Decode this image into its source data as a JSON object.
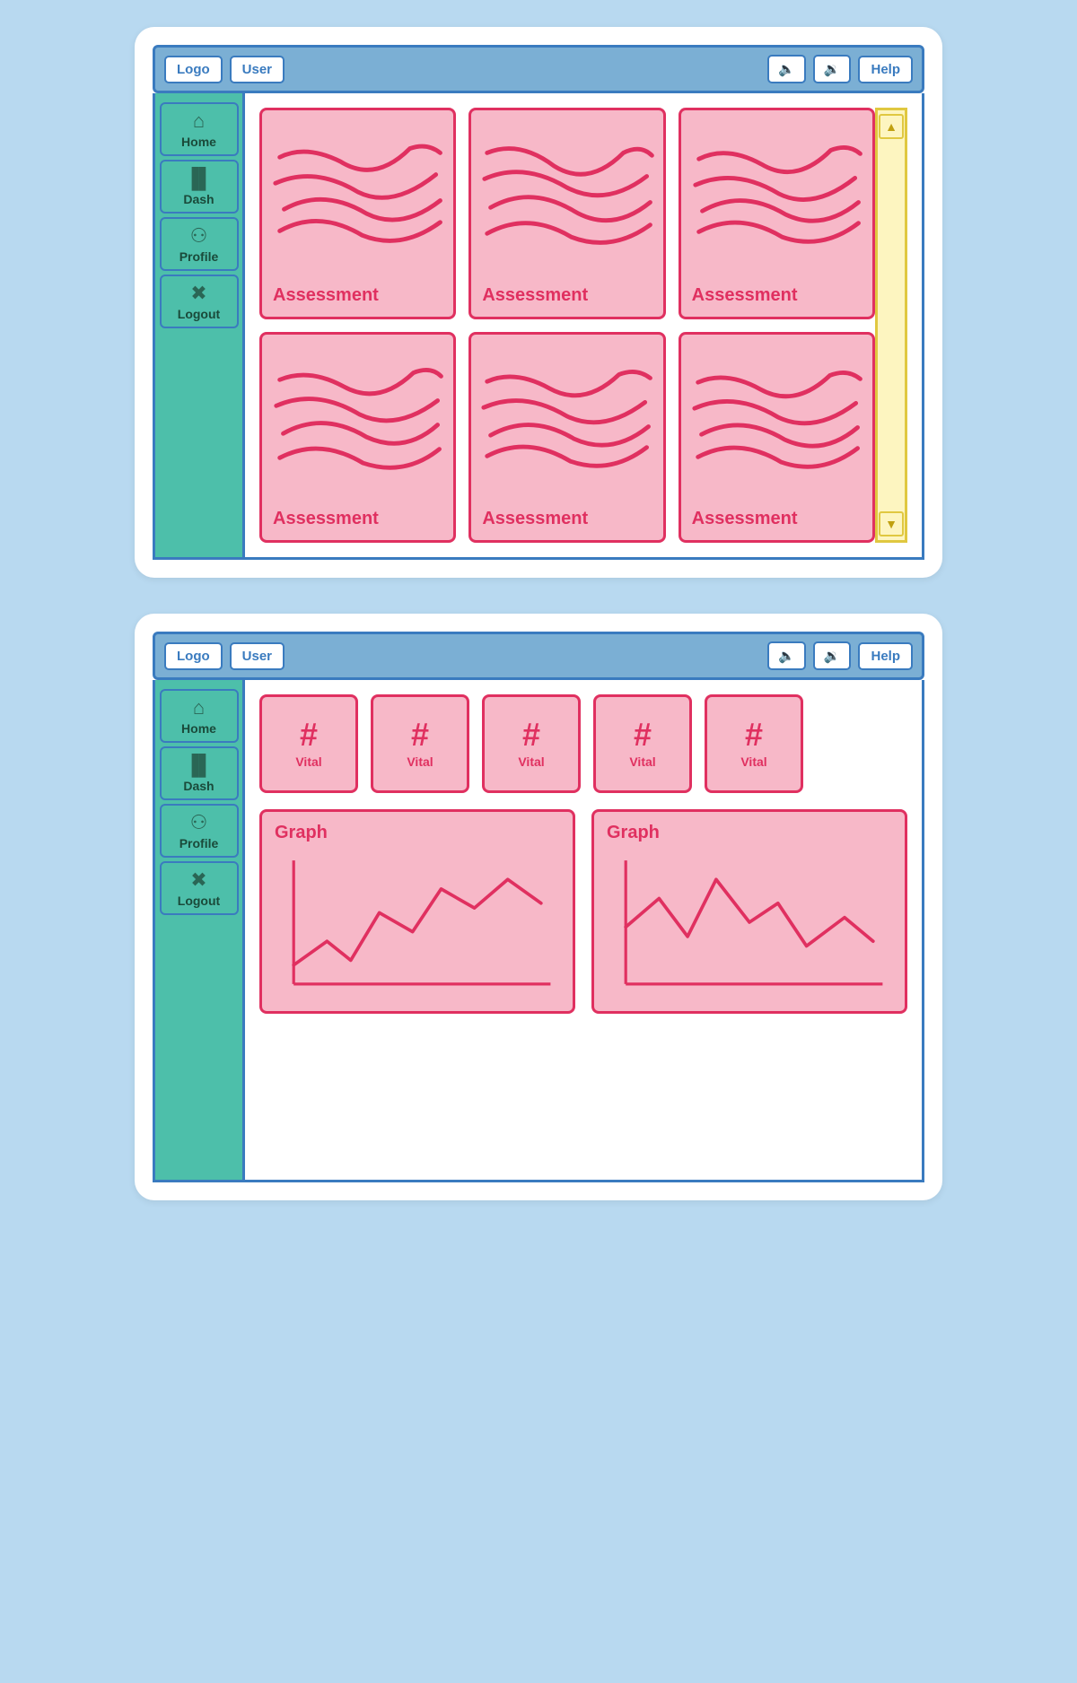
{
  "screens": [
    {
      "id": "screen1",
      "navbar": {
        "logo_label": "Logo",
        "user_label": "User",
        "speaker1_icon": "🔈",
        "speaker2_icon": "🔉",
        "help_label": "Help"
      },
      "sidebar": {
        "items": [
          {
            "id": "home",
            "icon": "⌂",
            "label": "Home"
          },
          {
            "id": "dash",
            "icon": "📊",
            "label": "Dash"
          },
          {
            "id": "profile",
            "icon": "👤",
            "label": "Profile"
          },
          {
            "id": "logout",
            "icon": "✖",
            "label": "Logout"
          }
        ]
      },
      "assessment_cards": [
        {
          "label": "Assessment"
        },
        {
          "label": "Assessment"
        },
        {
          "label": "Assessment"
        },
        {
          "label": "Assessment"
        },
        {
          "label": "Assessment"
        },
        {
          "label": "Assessment"
        }
      ],
      "scroll_up": "▲",
      "scroll_down": "▼"
    },
    {
      "id": "screen2",
      "navbar": {
        "logo_label": "Logo",
        "user_label": "User",
        "speaker1_icon": "🔈",
        "speaker2_icon": "🔉",
        "help_label": "Help"
      },
      "sidebar": {
        "items": [
          {
            "id": "home",
            "icon": "⌂",
            "label": "Home"
          },
          {
            "id": "dash",
            "icon": "📊",
            "label": "Dash"
          },
          {
            "id": "profile",
            "icon": "👤",
            "label": "Profile"
          },
          {
            "id": "logout",
            "icon": "✖",
            "label": "Logout"
          }
        ]
      },
      "vitals": [
        {
          "hash": "#",
          "label": "Vital"
        },
        {
          "hash": "#",
          "label": "Vital"
        },
        {
          "hash": "#",
          "label": "Vital"
        },
        {
          "hash": "#",
          "label": "Vital"
        },
        {
          "hash": "#",
          "label": "Vital"
        }
      ],
      "graphs": [
        {
          "title": "Graph"
        },
        {
          "title": "Graph"
        }
      ]
    }
  ]
}
